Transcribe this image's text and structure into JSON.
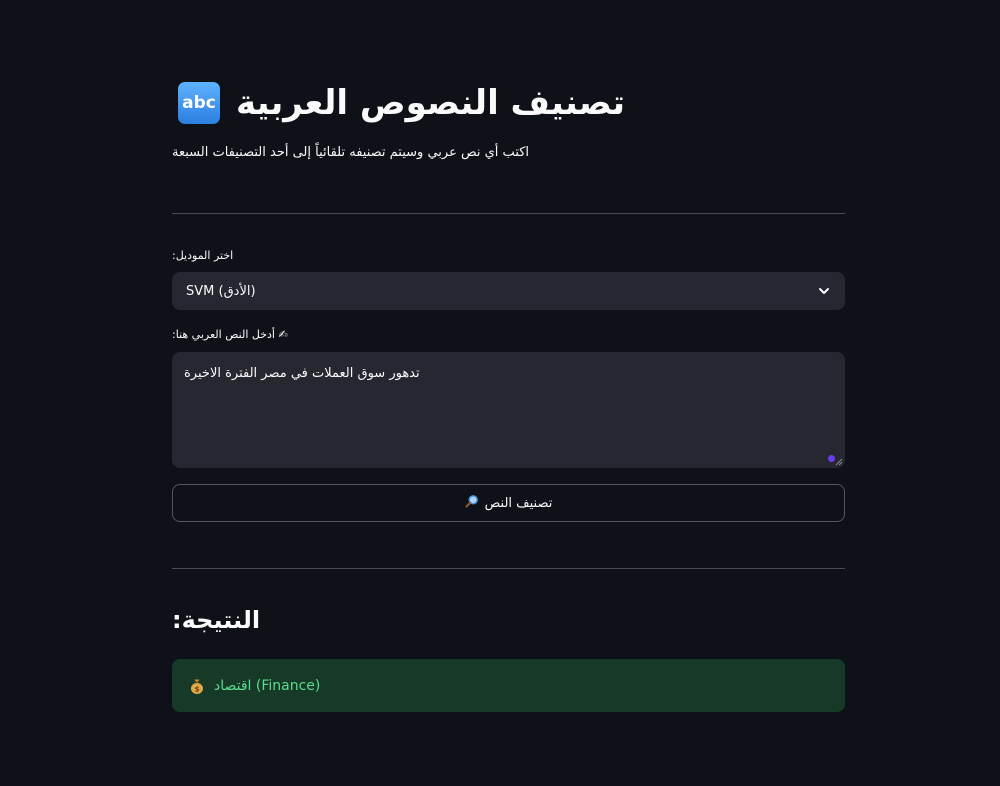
{
  "header": {
    "icon": "abc-icon",
    "icon_text": "abc",
    "title": "تصنيف النصوص العربية",
    "subtitle": "اكتب أي نص عربي وسيتم تصنيفه تلقائياً إلى أحد التصنيفات السبعة"
  },
  "model_select": {
    "label": ":اختر الموديل",
    "value": "SVM (الأدق)",
    "icon": "chevron-down-icon"
  },
  "text_input": {
    "label": ":أدخل النص العربي هنا ✍",
    "value": "تدهور سوق العملات في مصر الفترة الاخيرة"
  },
  "classify_button": {
    "label": "تصنيف النص",
    "icon": "magnifier-icon"
  },
  "result": {
    "heading": ":النتيجة",
    "text": "اقتصاد (Finance)",
    "icon": "money-bag-icon"
  },
  "colors": {
    "background": "#0e1117",
    "input_bg": "#262730",
    "success_bg": "#173928",
    "success_text": "#5cdb8d",
    "accent": "#6a3df0"
  }
}
